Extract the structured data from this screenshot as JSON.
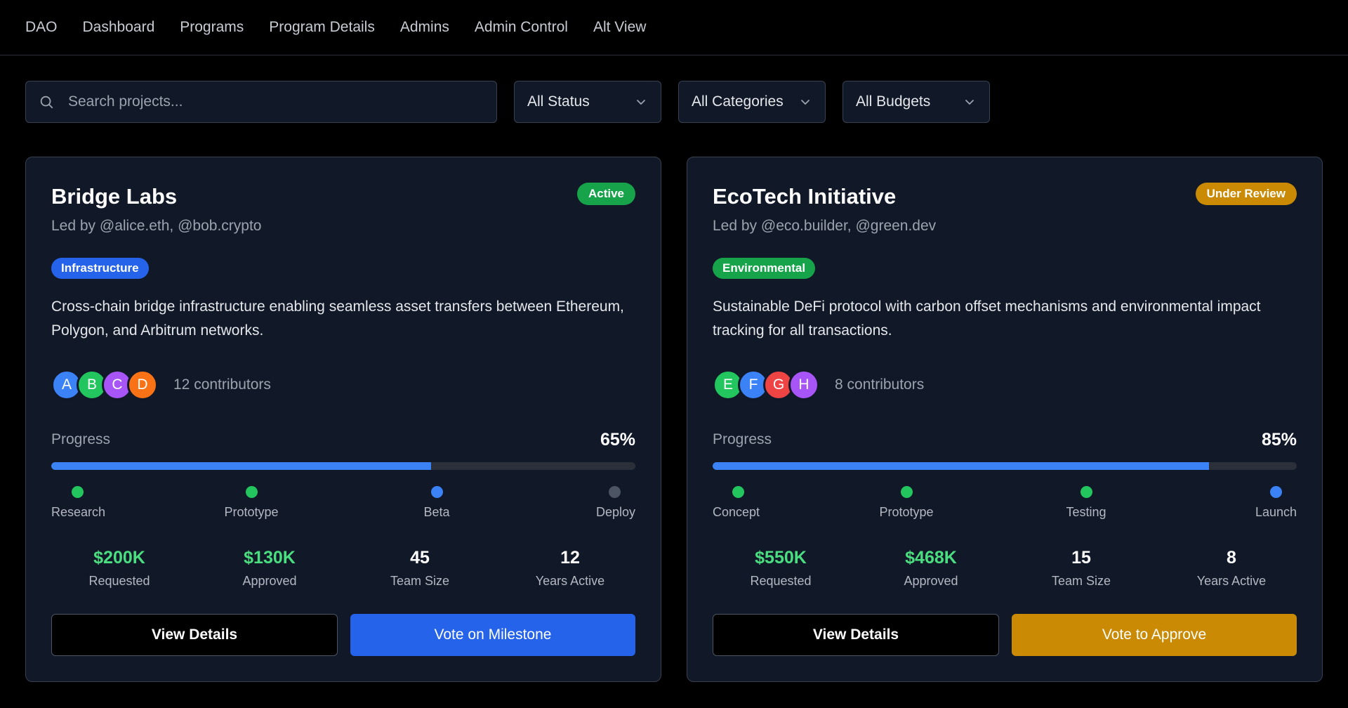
{
  "nav": {
    "items": [
      "DAO",
      "Dashboard",
      "Programs",
      "Program Details",
      "Admins",
      "Admin Control",
      "Alt View"
    ]
  },
  "filters": {
    "search_placeholder": "Search projects...",
    "status": "All Status",
    "categories": "All Categories",
    "budgets": "All Budgets"
  },
  "colors": {
    "green": "#22c55e",
    "blue": "#3b82f6",
    "amber": "#ca8a04",
    "gray_dot": "#4b5563"
  },
  "projects": [
    {
      "title": "Bridge Labs",
      "status": "Active",
      "status_color": "#16a34a",
      "lead": "Led by @alice.eth, @bob.crypto",
      "category": "Infrastructure",
      "category_color": "#2563eb",
      "description": "Cross-chain bridge infrastructure enabling seamless asset transfers between Ethereum, Polygon, and Arbitrum networks.",
      "avatars": [
        {
          "letter": "A",
          "color": "#3b82f6"
        },
        {
          "letter": "B",
          "color": "#22c55e"
        },
        {
          "letter": "C",
          "color": "#a855f7"
        },
        {
          "letter": "D",
          "color": "#f97316"
        }
      ],
      "contributors": "12 contributors",
      "progress_label": "Progress",
      "progress_text": "65%",
      "progress": 65,
      "milestones": [
        {
          "label": "Research",
          "state": "done"
        },
        {
          "label": "Prototype",
          "state": "done"
        },
        {
          "label": "Beta",
          "state": "current"
        },
        {
          "label": "Deploy",
          "state": "pending"
        }
      ],
      "stats": [
        {
          "value": "$200K",
          "label": "Requested",
          "accent": true
        },
        {
          "value": "$130K",
          "label": "Approved",
          "accent": true
        },
        {
          "value": "45",
          "label": "Team Size",
          "accent": false
        },
        {
          "value": "12",
          "label": "Years Active",
          "accent": false
        }
      ],
      "secondary_button": "View Details",
      "primary_button": "Vote on Milestone",
      "primary_color": "#2563eb"
    },
    {
      "title": "EcoTech Initiative",
      "status": "Under Review",
      "status_color": "#ca8a04",
      "lead": "Led by @eco.builder, @green.dev",
      "category": "Environmental",
      "category_color": "#16a34a",
      "description": "Sustainable DeFi protocol with carbon offset mechanisms and environmental impact tracking for all transactions.",
      "avatars": [
        {
          "letter": "E",
          "color": "#22c55e"
        },
        {
          "letter": "F",
          "color": "#3b82f6"
        },
        {
          "letter": "G",
          "color": "#ef4444"
        },
        {
          "letter": "H",
          "color": "#a855f7"
        }
      ],
      "contributors": "8 contributors",
      "progress_label": "Progress",
      "progress_text": "85%",
      "progress": 85,
      "milestones": [
        {
          "label": "Concept",
          "state": "done"
        },
        {
          "label": "Prototype",
          "state": "done"
        },
        {
          "label": "Testing",
          "state": "done"
        },
        {
          "label": "Launch",
          "state": "current"
        }
      ],
      "stats": [
        {
          "value": "$550K",
          "label": "Requested",
          "accent": true
        },
        {
          "value": "$468K",
          "label": "Approved",
          "accent": true
        },
        {
          "value": "15",
          "label": "Team Size",
          "accent": false
        },
        {
          "value": "8",
          "label": "Years Active",
          "accent": false
        }
      ],
      "secondary_button": "View Details",
      "primary_button": "Vote to Approve",
      "primary_color": "#ca8a04"
    }
  ]
}
